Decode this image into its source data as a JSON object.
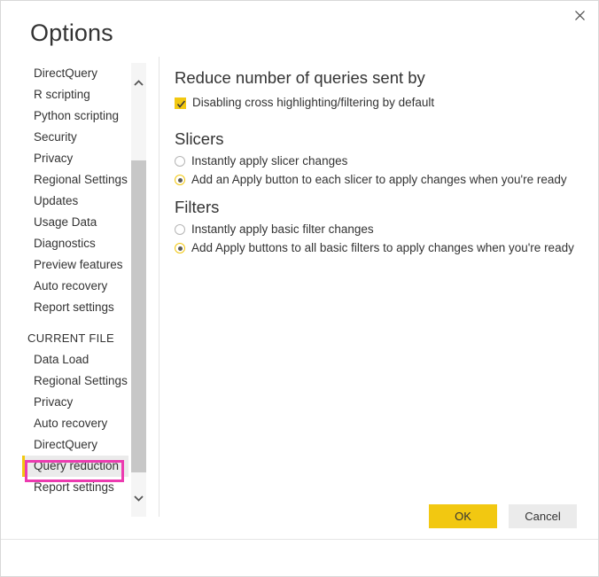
{
  "dialog": {
    "title": "Options",
    "close_icon": "close-icon"
  },
  "sidebar": {
    "global_items": [
      {
        "label": "DirectQuery",
        "selected": false
      },
      {
        "label": "R scripting",
        "selected": false
      },
      {
        "label": "Python scripting",
        "selected": false
      },
      {
        "label": "Security",
        "selected": false
      },
      {
        "label": "Privacy",
        "selected": false
      },
      {
        "label": "Regional Settings",
        "selected": false
      },
      {
        "label": "Updates",
        "selected": false
      },
      {
        "label": "Usage Data",
        "selected": false
      },
      {
        "label": "Diagnostics",
        "selected": false
      },
      {
        "label": "Preview features",
        "selected": false
      },
      {
        "label": "Auto recovery",
        "selected": false
      },
      {
        "label": "Report settings",
        "selected": false
      }
    ],
    "section_label": "CURRENT FILE",
    "file_items": [
      {
        "label": "Data Load",
        "selected": false
      },
      {
        "label": "Regional Settings",
        "selected": false
      },
      {
        "label": "Privacy",
        "selected": false
      },
      {
        "label": "Auto recovery",
        "selected": false
      },
      {
        "label": "DirectQuery",
        "selected": false
      },
      {
        "label": "Query reduction",
        "selected": true
      },
      {
        "label": "Report settings",
        "selected": false
      }
    ],
    "scrollbar": {
      "up_icon": "chevron-up-icon",
      "down_icon": "chevron-down-icon"
    },
    "annotation_color": "#ec3bb0",
    "selected_accent_color": "#f2c811"
  },
  "main": {
    "reduce": {
      "heading": "Reduce number of queries sent by",
      "checkbox": {
        "label": "Disabling cross highlighting/filtering by default",
        "checked": true
      }
    },
    "slicers": {
      "heading": "Slicers",
      "options": [
        {
          "label": "Instantly apply slicer changes",
          "checked": false
        },
        {
          "label": "Add an Apply button to each slicer to apply changes when you're ready",
          "checked": true
        }
      ]
    },
    "filters": {
      "heading": "Filters",
      "options": [
        {
          "label": "Instantly apply basic filter changes",
          "checked": false
        },
        {
          "label": "Add Apply buttons to all basic filters to apply changes when you're ready",
          "checked": true
        }
      ]
    }
  },
  "footer": {
    "ok_label": "OK",
    "cancel_label": "Cancel",
    "ok_color": "#f2c811",
    "cancel_color": "#ebebeb"
  }
}
